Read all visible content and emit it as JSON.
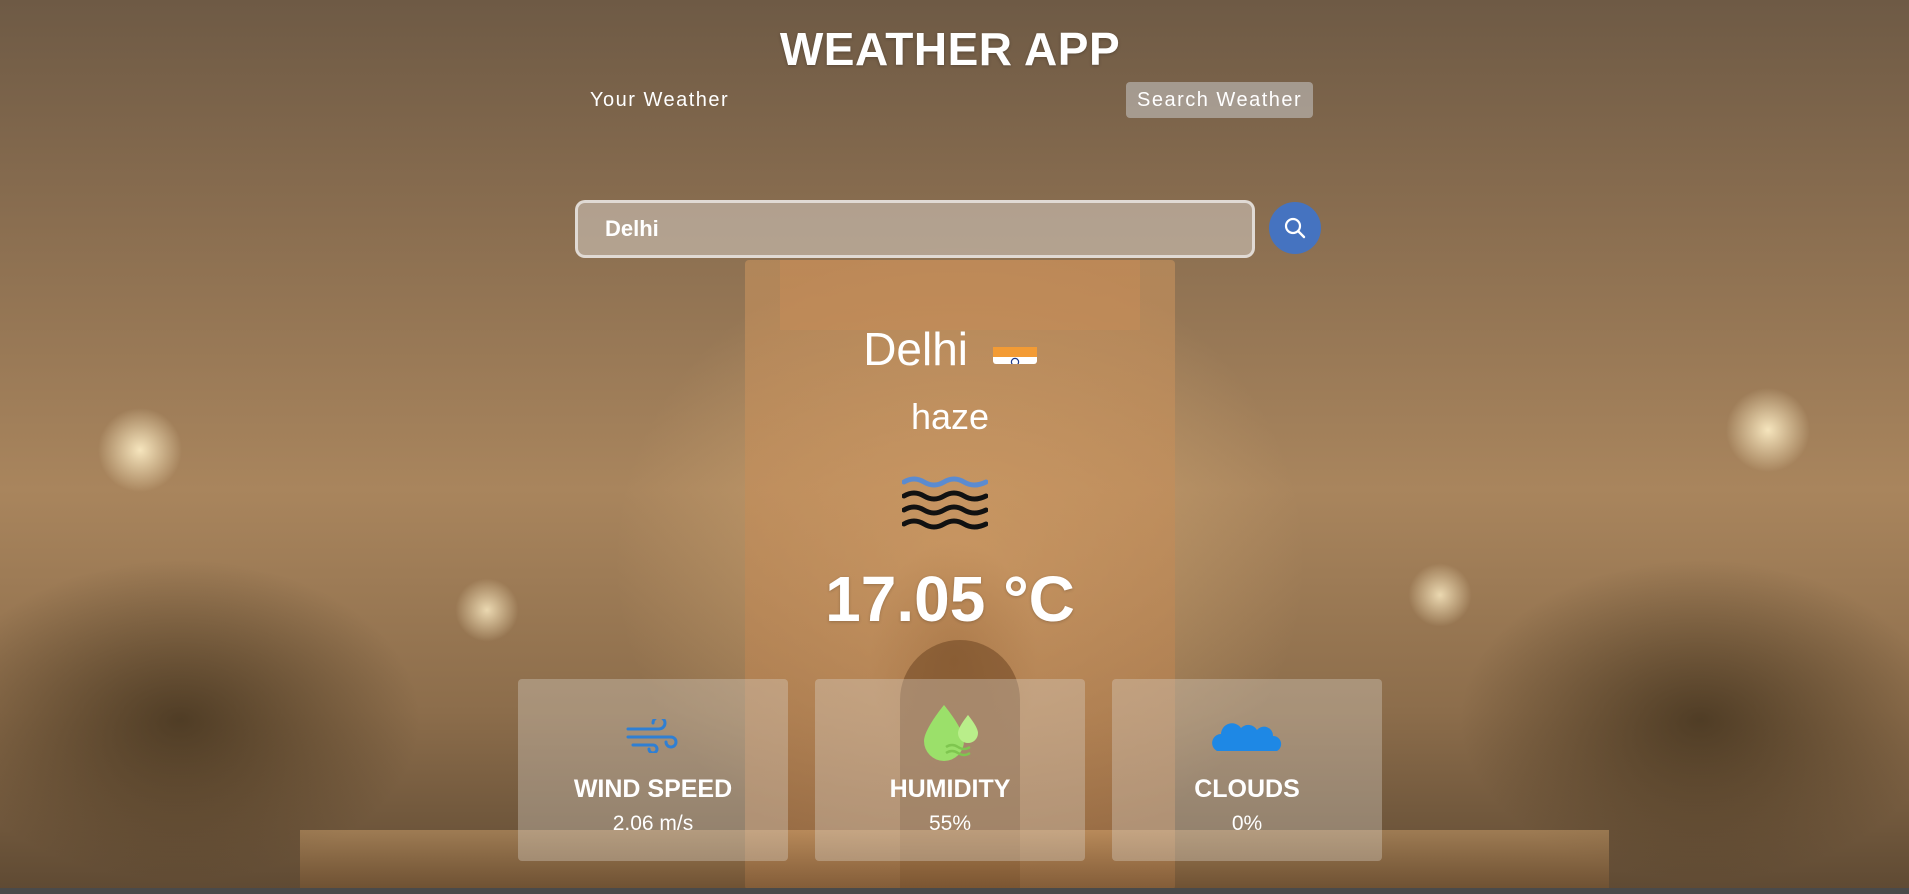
{
  "app": {
    "title": "WEATHER APP"
  },
  "tabs": [
    {
      "label": "Your Weather",
      "active": false
    },
    {
      "label": "Search Weather",
      "active": true
    }
  ],
  "search": {
    "value": "Delhi",
    "button_icon": "search-icon"
  },
  "weather": {
    "city": "Delhi",
    "country_flag": "india-flag-icon",
    "condition": "haze",
    "condition_icon": "haze-icon",
    "temperature": "17.05 °C"
  },
  "cards": [
    {
      "icon": "wind-icon",
      "label": "WIND SPEED",
      "value": "2.06 m/s"
    },
    {
      "icon": "humidity-icon",
      "label": "HUMIDITY",
      "value": "55%"
    },
    {
      "icon": "cloud-icon",
      "label": "CLOUDS",
      "value": "0%"
    }
  ],
  "colors": {
    "search_button": "#4573c0",
    "tab_active_bg": "#c8c8c8",
    "text": "#ffffff"
  }
}
